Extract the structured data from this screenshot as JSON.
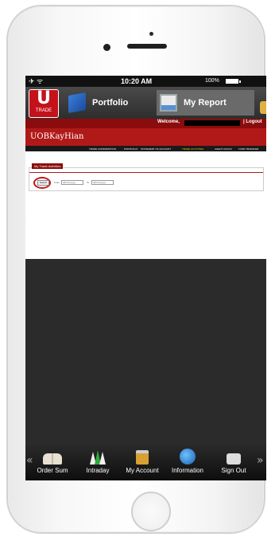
{
  "status_bar": {
    "left_icons": "✈ ᯤ",
    "time": "10:20 AM",
    "battery_text": "100%",
    "battery_level": 1.0
  },
  "header": {
    "logo_letter": "U",
    "logo_text": "TRADE",
    "nav_items": [
      {
        "label": "Portfolio",
        "icon": "book-icon"
      },
      {
        "label": "My Report",
        "icon": "report-icon"
      }
    ]
  },
  "webpage": {
    "welcome_text": "Welcome,",
    "logout_text": "| Logout",
    "brand": "UOBKayHian",
    "menu_items": [
      "TRADE CONFIRMATION",
      "PORTFOLIO",
      "STATEMENT OF ACCOUNT",
      "TRADE ACTIVITIES",
      "AGENT ACCOU",
      "FUND TRANSFER"
    ],
    "active_menu": "TRADE ACTIVITIES",
    "panel_title": "My Trade Activities",
    "search_button": "Search",
    "from_label": "From",
    "to_label": "To",
    "from_value": "dd/mm/yyyy",
    "to_value": "dd/mm/yyyy"
  },
  "tabbar": {
    "left_arrow": "«",
    "right_arrow": "»",
    "tabs": [
      {
        "label": "Order Sum",
        "icon": "open-book-icon"
      },
      {
        "label": "Intraday",
        "icon": "arrows-icon"
      },
      {
        "label": "My Account",
        "icon": "lock-icon"
      },
      {
        "label": "Information",
        "icon": "globe-icon"
      },
      {
        "label": "Sign Out",
        "icon": "signout-icon"
      }
    ]
  }
}
